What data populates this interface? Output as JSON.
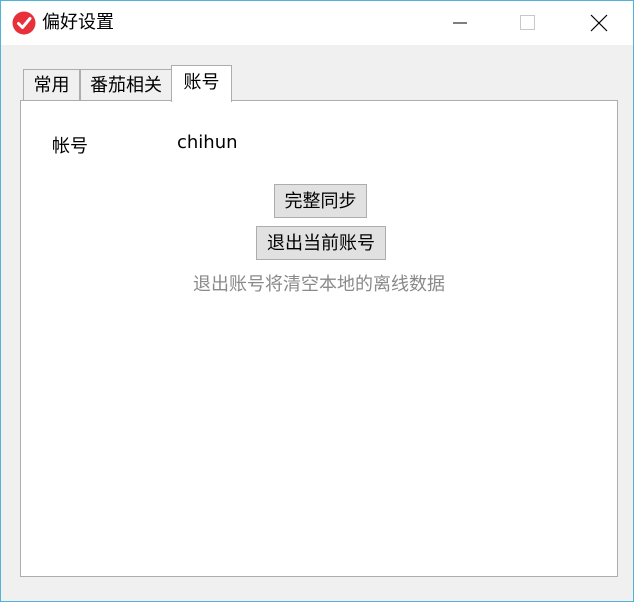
{
  "window": {
    "title": "偏好设置",
    "icon": "pomodoro-check-icon",
    "accent_color": "#e8303a"
  },
  "tabs": [
    {
      "label": "常用",
      "active": false
    },
    {
      "label": "番茄相关",
      "active": false
    },
    {
      "label": "账号",
      "active": true
    }
  ],
  "account": {
    "label": "帐号",
    "value": "chihun",
    "sync_button": "完整同步",
    "logout_button": "退出当前账号",
    "logout_hint": "退出账号将清空本地的离线数据"
  }
}
